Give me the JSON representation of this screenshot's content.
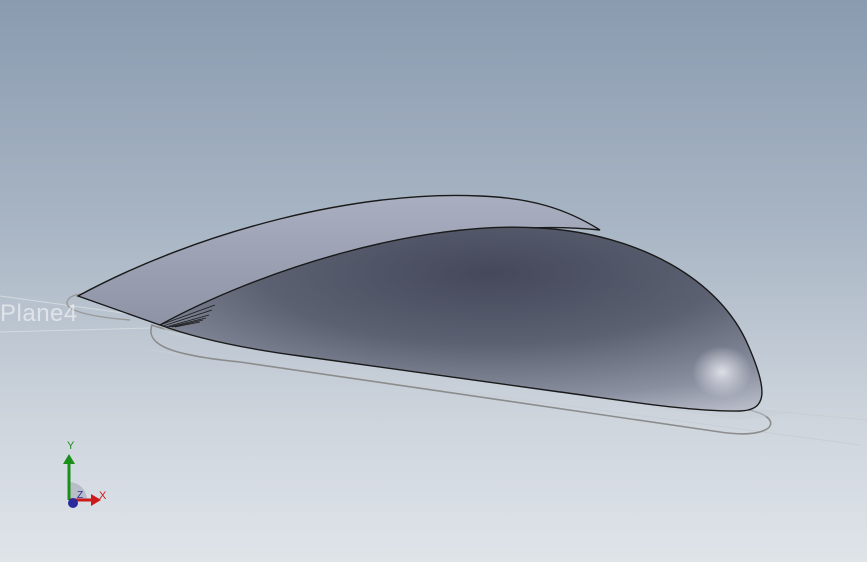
{
  "viewport": {
    "background_top": "#8a9bb0",
    "background_bottom": "#dfe4e9"
  },
  "plane": {
    "label": "Plane4"
  },
  "model": {
    "part_color": "#5a5f6e",
    "edge_color": "#1a1a1a",
    "sketch_color": "#8c8c8c"
  },
  "triad": {
    "x_label": "X",
    "y_label": "Y",
    "z_label": "Z",
    "x_color": "#cc1a1a",
    "y_color": "#1a8f1a",
    "z_color": "#2a2a9a"
  }
}
